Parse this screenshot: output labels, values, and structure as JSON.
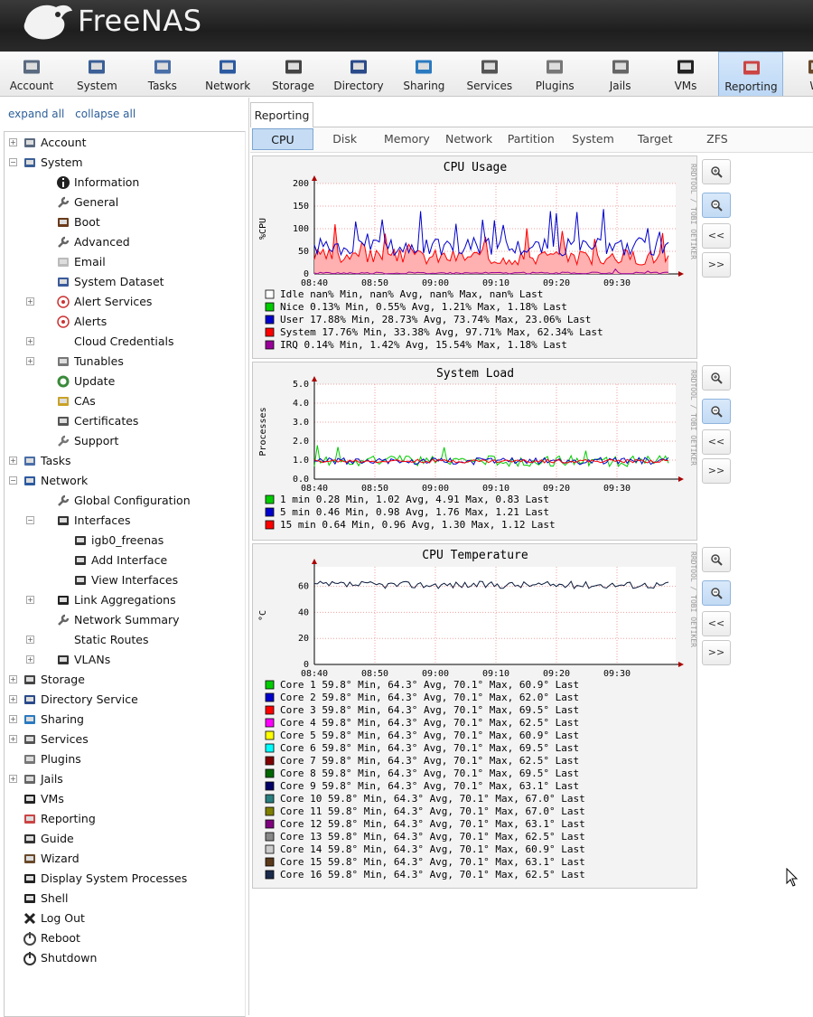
{
  "app": {
    "brand": "FreeNAS"
  },
  "toolbar": [
    {
      "label": "Account",
      "icon": "account-icon"
    },
    {
      "label": "System",
      "icon": "system-icon"
    },
    {
      "label": "Tasks",
      "icon": "tasks-icon"
    },
    {
      "label": "Network",
      "icon": "network-icon"
    },
    {
      "label": "Storage",
      "icon": "storage-icon"
    },
    {
      "label": "Directory",
      "icon": "directory-icon"
    },
    {
      "label": "Sharing",
      "icon": "sharing-icon"
    },
    {
      "label": "Services",
      "icon": "services-icon"
    },
    {
      "label": "Plugins",
      "icon": "plugins-icon"
    },
    {
      "label": "Jails",
      "icon": "jails-icon"
    },
    {
      "label": "VMs",
      "icon": "vms-icon"
    },
    {
      "label": "Reporting",
      "icon": "reporting-icon",
      "active": true
    },
    {
      "label": "Wi",
      "icon": "wizard-icon"
    }
  ],
  "sidebar": {
    "expand_all": "expand all",
    "collapse_all": "collapse all",
    "items": [
      {
        "label": "Account",
        "level": 0,
        "toggle": "+",
        "icon": "account-icon"
      },
      {
        "label": "System",
        "level": 0,
        "toggle": "-",
        "icon": "system-icon"
      },
      {
        "label": "Information",
        "level": 1,
        "icon": "info-icon"
      },
      {
        "label": "General",
        "level": 1,
        "icon": "wrench-icon"
      },
      {
        "label": "Boot",
        "level": 1,
        "icon": "boot-icon"
      },
      {
        "label": "Advanced",
        "level": 1,
        "icon": "wrench-icon"
      },
      {
        "label": "Email",
        "level": 1,
        "icon": "email-icon"
      },
      {
        "label": "System Dataset",
        "level": 1,
        "icon": "dataset-icon"
      },
      {
        "label": "Alert Services",
        "level": 1,
        "toggle": "+",
        "icon": "alert-icon"
      },
      {
        "label": "Alerts",
        "level": 1,
        "icon": "alert-icon"
      },
      {
        "label": "Cloud Credentials",
        "level": 1,
        "toggle": "+",
        "icon": ""
      },
      {
        "label": "Tunables",
        "level": 1,
        "toggle": "+",
        "icon": "tunables-icon"
      },
      {
        "label": "Update",
        "level": 1,
        "icon": "update-icon"
      },
      {
        "label": "CAs",
        "level": 1,
        "icon": "ca-icon"
      },
      {
        "label": "Certificates",
        "level": 1,
        "icon": "certificate-icon"
      },
      {
        "label": "Support",
        "level": 1,
        "icon": "support-icon"
      },
      {
        "label": "Tasks",
        "level": 0,
        "toggle": "+",
        "icon": "tasks-icon"
      },
      {
        "label": "Network",
        "level": 0,
        "toggle": "-",
        "icon": "network-icon"
      },
      {
        "label": "Global Configuration",
        "level": 1,
        "icon": "wrench-icon"
      },
      {
        "label": "Interfaces",
        "level": 1,
        "toggle": "-",
        "icon": "interface-icon"
      },
      {
        "label": "igb0_freenas",
        "level": 2,
        "icon": "interface-icon"
      },
      {
        "label": "Add Interface",
        "level": 2,
        "icon": "add-interface-icon"
      },
      {
        "label": "View Interfaces",
        "level": 2,
        "icon": "view-interfaces-icon"
      },
      {
        "label": "Link Aggregations",
        "level": 1,
        "toggle": "+",
        "icon": "link-aggregation-icon"
      },
      {
        "label": "Network Summary",
        "level": 1,
        "icon": "wrench-icon"
      },
      {
        "label": "Static Routes",
        "level": 1,
        "toggle": "+",
        "icon": ""
      },
      {
        "label": "VLANs",
        "level": 1,
        "toggle": "+",
        "icon": "vlan-icon"
      },
      {
        "label": "Storage",
        "level": 0,
        "toggle": "+",
        "icon": "storage-icon"
      },
      {
        "label": "Directory Service",
        "level": 0,
        "toggle": "+",
        "icon": "directory-icon"
      },
      {
        "label": "Sharing",
        "level": 0,
        "toggle": "+",
        "icon": "sharing-icon"
      },
      {
        "label": "Services",
        "level": 0,
        "toggle": "+",
        "icon": "services-icon"
      },
      {
        "label": "Plugins",
        "level": 0,
        "icon": "plugins-icon"
      },
      {
        "label": "Jails",
        "level": 0,
        "toggle": "+",
        "icon": "jails-icon"
      },
      {
        "label": "VMs",
        "level": 0,
        "icon": "vms-icon"
      },
      {
        "label": "Reporting",
        "level": 0,
        "icon": "reporting-icon"
      },
      {
        "label": "Guide",
        "level": 0,
        "icon": "guide-icon"
      },
      {
        "label": "Wizard",
        "level": 0,
        "icon": "wizard-icon"
      },
      {
        "label": "Display System Processes",
        "level": 0,
        "icon": "processes-icon"
      },
      {
        "label": "Shell",
        "level": 0,
        "icon": "shell-icon"
      },
      {
        "label": "Log Out",
        "level": 0,
        "icon": "logout-icon"
      },
      {
        "label": "Reboot",
        "level": 0,
        "icon": "reboot-icon"
      },
      {
        "label": "Shutdown",
        "level": 0,
        "icon": "shutdown-icon"
      }
    ]
  },
  "main": {
    "tab": "Reporting",
    "subtabs": [
      "CPU",
      "Disk",
      "Memory",
      "Network",
      "Partition",
      "System",
      "Target",
      "ZFS"
    ],
    "active_subtab": "CPU",
    "graph_buttons": [
      "zoom-in-icon",
      "zoom-out-icon",
      "<<",
      ">>"
    ]
  },
  "graphs": [
    {
      "title": "CPU Usage",
      "ylabel": "%CPU",
      "watermark": "RRDTOOL / TOBI OETIKER",
      "xticks": [
        "08:40",
        "08:50",
        "09:00",
        "09:10",
        "09:20",
        "09:30"
      ],
      "yticks": [
        "0",
        "50",
        "100",
        "150",
        "200"
      ],
      "legend": [
        {
          "color": "#ffffff",
          "text": "Idle      nan% Min,    nan% Avg,    nan% Max,    nan% Last"
        },
        {
          "color": "#00cc00",
          "text": "Nice     0.13% Min,   0.55% Avg,   1.21% Max,   1.18% Last"
        },
        {
          "color": "#0000cc",
          "text": "User    17.88% Min,  28.73% Avg,  73.74% Max,  23.06% Last"
        },
        {
          "color": "#ff0000",
          "text": "System  17.76% Min,  33.38% Avg,  97.71% Max,  62.34% Last"
        },
        {
          "color": "#990099",
          "text": "IRQ      0.14% Min,   1.42% Avg,  15.54% Max,   1.18% Last"
        }
      ]
    },
    {
      "title": "System Load",
      "ylabel": "Processes",
      "watermark": "RRDTOOL / TOBI OETIKER",
      "xticks": [
        "08:40",
        "08:50",
        "09:00",
        "09:10",
        "09:20",
        "09:30"
      ],
      "yticks": [
        "0.0",
        "1.0",
        "2.0",
        "3.0",
        "4.0",
        "5.0"
      ],
      "legend": [
        {
          "color": "#00cc00",
          "text": " 1 min  0.28 Min,  1.02 Avg,  4.91 Max,  0.83 Last"
        },
        {
          "color": "#0000cc",
          "text": " 5 min  0.46 Min,  0.98 Avg,  1.76 Max,  1.21 Last"
        },
        {
          "color": "#ff0000",
          "text": "15 min  0.64 Min,  0.96 Avg,  1.30 Max,  1.12 Last"
        }
      ]
    },
    {
      "title": "CPU Temperature",
      "ylabel": "°C",
      "watermark": "RRDTOOL / TOBI OETIKER",
      "xticks": [
        "08:40",
        "08:50",
        "09:00",
        "09:10",
        "09:20",
        "09:30"
      ],
      "yticks": [
        "0",
        "20",
        "40",
        "60"
      ],
      "legend": [
        {
          "color": "#00cc00",
          "text": "Core 1   59.8° Min,   64.3° Avg,   70.1° Max,   60.9° Last"
        },
        {
          "color": "#0000cc",
          "text": "Core 2   59.8° Min,   64.3° Avg,   70.1° Max,   62.0° Last"
        },
        {
          "color": "#ff0000",
          "text": "Core 3   59.8° Min,   64.3° Avg,   70.1° Max,   69.5° Last"
        },
        {
          "color": "#ff00ff",
          "text": "Core 4   59.8° Min,   64.3° Avg,   70.1° Max,   62.5° Last"
        },
        {
          "color": "#ffff00",
          "text": "Core 5   59.8° Min,   64.3° Avg,   70.1° Max,   60.9° Last"
        },
        {
          "color": "#00ffff",
          "text": "Core 6   59.8° Min,   64.3° Avg,   70.1° Max,   69.5° Last"
        },
        {
          "color": "#800000",
          "text": "Core 7   59.8° Min,   64.3° Avg,   70.1° Max,   62.5° Last"
        },
        {
          "color": "#006600",
          "text": "Core 8   59.8° Min,   64.3° Avg,   70.1° Max,   69.5° Last"
        },
        {
          "color": "#000066",
          "text": "Core 9   59.8° Min,   64.3° Avg,   70.1° Max,   63.1° Last"
        },
        {
          "color": "#2a7f7f",
          "text": "Core 10   59.8° Min,   64.3° Avg,   70.1° Max,   67.0° Last"
        },
        {
          "color": "#7f7f00",
          "text": "Core 11   59.8° Min,   64.3° Avg,   70.1° Max,   67.0° Last"
        },
        {
          "color": "#7f007f",
          "text": "Core 12   59.8° Min,   64.3° Avg,   70.1° Max,   63.1° Last"
        },
        {
          "color": "#888888",
          "text": "Core 13   59.8° Min,   64.3° Avg,   70.1° Max,   62.5° Last"
        },
        {
          "color": "#cccccc",
          "text": "Core 14   59.8° Min,   64.3° Avg,   70.1° Max,   60.9° Last"
        },
        {
          "color": "#5a3a1a",
          "text": "Core 15   59.8° Min,   64.3° Avg,   70.1° Max,   63.1° Last"
        },
        {
          "color": "#1a2a4a",
          "text": "Core 16   59.8° Min,   64.3° Avg,   70.1° Max,   62.5° Last"
        }
      ]
    }
  ]
}
